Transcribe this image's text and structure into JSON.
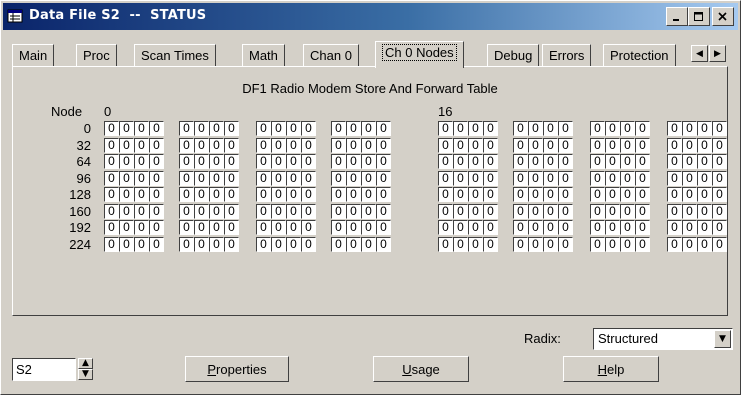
{
  "window": {
    "title": "Data File S2  --  STATUS",
    "icon": "data-file-icon",
    "controls": [
      "minimize",
      "maximize",
      "close"
    ]
  },
  "tabs": [
    {
      "label": "Main"
    },
    {
      "label": "Proc"
    },
    {
      "label": "Scan Times"
    },
    {
      "label": "Math"
    },
    {
      "label": "Chan 0"
    },
    {
      "label": "Ch 0 Nodes",
      "active": true
    },
    {
      "label": "Debug"
    },
    {
      "label": "Errors"
    },
    {
      "label": "Protection"
    }
  ],
  "table": {
    "title": "DF1 Radio Modem Store And Forward Table",
    "node_header": "Node",
    "col_header_0": "0",
    "col_header_16": "16",
    "row_labels": [
      "0",
      "32",
      "64",
      "96",
      "128",
      "160",
      "192",
      "224"
    ],
    "bit_value": "0"
  },
  "radix": {
    "label": "Radix:",
    "value": "Structured"
  },
  "address": {
    "value": "S2"
  },
  "buttons": {
    "properties": {
      "pre": "",
      "accel": "P",
      "post": "roperties"
    },
    "usage": {
      "pre": "",
      "accel": "U",
      "post": "sage"
    },
    "help": {
      "pre": "",
      "accel": "H",
      "post": "elp"
    }
  },
  "colors": {
    "face": "#d4d0c8",
    "title_start": "#0a246a",
    "title_end": "#a6caf0",
    "field": "#ffffff"
  }
}
